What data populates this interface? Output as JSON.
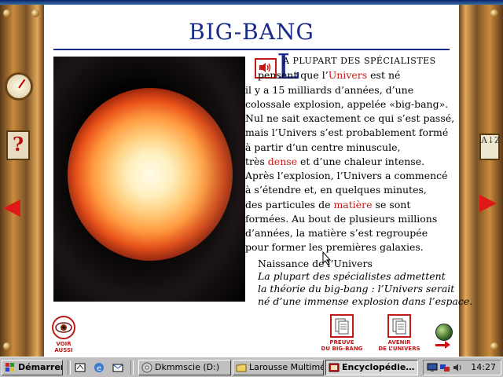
{
  "app": {
    "title": "BIG-BANG"
  },
  "article": {
    "dropcap": "L",
    "lines": [
      [
        {
          "t": "A PLUPART DES SPÉCIALISTES"
        }
      ],
      [
        {
          "t": "pensent que l’"
        },
        {
          "t": "Univers",
          "link": true
        },
        {
          "t": " est né"
        }
      ],
      [
        {
          "t": "il y a 15 milliards d’années, d’une"
        }
      ],
      [
        {
          "t": "colossale explosion, appelée «big-bang»."
        }
      ],
      [
        {
          "t": "Nul ne sait exactement ce qui s’est passé,"
        }
      ],
      [
        {
          "t": "mais l’Univers s’est probablement formé"
        }
      ],
      [
        {
          "t": "à partir d’un centre minuscule,"
        }
      ],
      [
        {
          "t": "très "
        },
        {
          "t": "dense",
          "link": true
        },
        {
          "t": " et d’une chaleur intense."
        }
      ],
      [
        {
          "t": "Après l’explosion, l’Univers a commencé"
        }
      ],
      [
        {
          "t": "à s’étendre et, en quelques minutes,"
        }
      ],
      [
        {
          "t": "des particules de "
        },
        {
          "t": "matière",
          "link": true
        },
        {
          "t": " se sont"
        }
      ],
      [
        {
          "t": "formées. Au bout de plusieurs millions"
        }
      ],
      [
        {
          "t": "d’années, la matière s’est regroupée"
        }
      ],
      [
        {
          "t": "pour former les premières galaxies."
        }
      ]
    ]
  },
  "caption": {
    "title": "Naissance de l’Univers",
    "lines": [
      "La plupart des spécialistes admettent",
      "la théorie du big-bang : l’Univers serait",
      "né d’une immense explosion dans l’espace."
    ]
  },
  "footer": {
    "see_also": [
      "VOIR",
      "AUSSI"
    ],
    "prev": [
      "PREUVE",
      "DU BIG-BANG"
    ],
    "next": [
      "AVENIR",
      "DE L’UNIVERS"
    ]
  },
  "frame": {
    "az": "A↓Z"
  },
  "taskbar": {
    "start": "Démarrer",
    "tasks": [
      "Dkmmscie (D:)",
      "Larousse Multimé…",
      "Encyclopédie…"
    ],
    "clock": "14:27"
  },
  "colors": {
    "accent": "#1a2a8a",
    "link": "#c81818",
    "taskbar": "#c0c0c0"
  }
}
